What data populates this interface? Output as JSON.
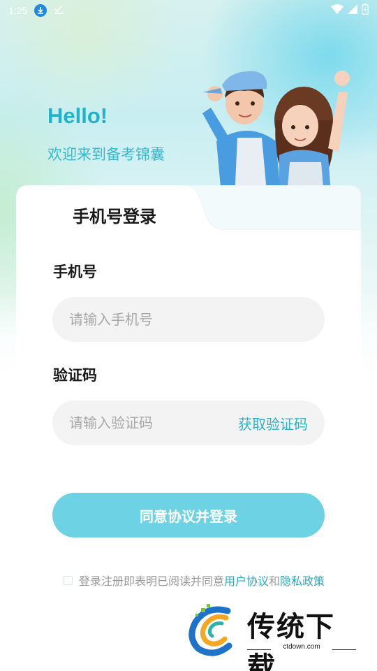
{
  "status_bar": {
    "time": "1:25"
  },
  "header": {
    "greeting": "Hello!",
    "welcome": "欢迎来到备考锦囊"
  },
  "login_tab": {
    "title": "手机号登录"
  },
  "phone": {
    "label": "手机号",
    "placeholder": "请输入手机号"
  },
  "code": {
    "label": "验证码",
    "placeholder": "请输入验证码",
    "get_code": "获取验证码"
  },
  "submit": {
    "label": "同意协议并登录"
  },
  "agreement": {
    "prefix": "登录注册即表明已阅读并同意",
    "user_agreement": "用户协议",
    "and": "和",
    "privacy_policy": "隐私政策",
    "checked": false
  },
  "watermark": {
    "brand": "传统下载",
    "url": "ctdown.com"
  },
  "colors": {
    "accent": "#22b3c8",
    "button": "#6dd3e4",
    "link": "#2aa9c0"
  }
}
